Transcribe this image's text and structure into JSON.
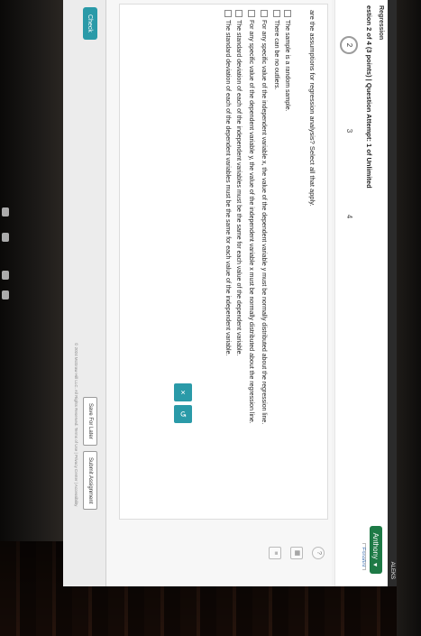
{
  "system_bar": {
    "status": "ALEKS"
  },
  "header": {
    "topic": "Regression",
    "question_info": "estion 2 of 4 (3 points)  |  Question Attempt: 1 of Unlimited",
    "user_name": "Anthony",
    "language_link": "Español"
  },
  "nav": {
    "items": [
      "2",
      "3",
      "4"
    ],
    "active_index": 0
  },
  "question": {
    "prompt": "are the assumptions for regression analysis? Select all that apply.",
    "options": [
      "The sample is a random sample.",
      "There can be no outliers.",
      "For any specific value of the independent variable x, the value of the dependent variable y must be normally distributed about the regression line.",
      "For any specific value of the dependent variable y, the value of the independent variable x must be normally distributed about the regression line.",
      "The standard deviation of each of the independent variables must be the same for each value of the dependent variable.",
      "The standard deviation of each of the dependent variables must be the same for each value of the independent variable."
    ]
  },
  "answer_buttons": {
    "clear": "×",
    "undo": "↺"
  },
  "footer": {
    "check": "Check",
    "save": "Save For Later",
    "submit": "Submit Assignment",
    "copyright": "© 2024 McGraw Hill LLC. All Rights Reserved.  Terms of Use  |  Privacy Center  |  Accessibility"
  },
  "colors": {
    "accent": "#2a9aa8",
    "user_menu": "#1e7a46"
  },
  "icons": [
    "chevron-down-icon",
    "calculator-icon",
    "data-icon",
    "help-icon"
  ]
}
